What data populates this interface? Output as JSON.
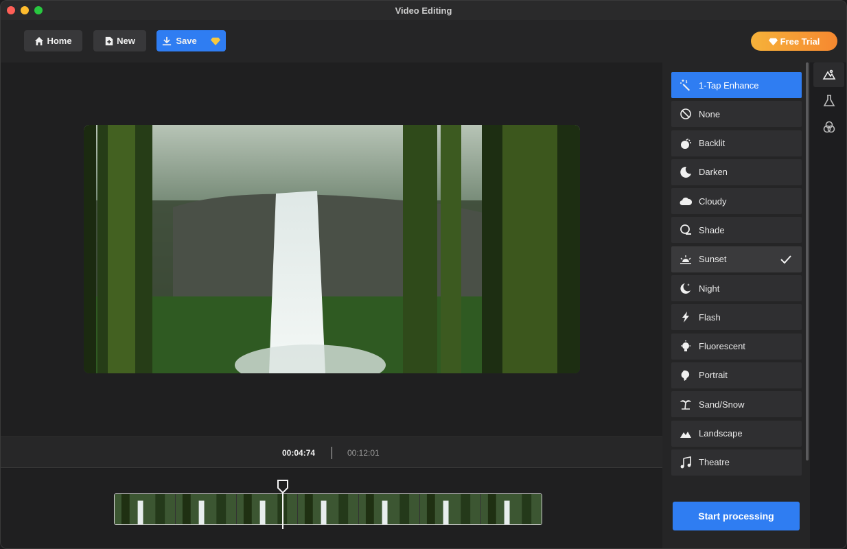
{
  "window": {
    "title": "Video Editing"
  },
  "toolbar": {
    "home_label": "Home",
    "new_label": "New",
    "save_label": "Save",
    "trial_label": "Free Trial"
  },
  "time": {
    "current": "00:04:74",
    "total": "00:12:01"
  },
  "presets": {
    "items": [
      {
        "label": "1-Tap Enhance",
        "icon": "magic-wand-icon",
        "state": "active"
      },
      {
        "label": "None",
        "icon": "none-icon",
        "state": ""
      },
      {
        "label": "Backlit",
        "icon": "backlit-icon",
        "state": ""
      },
      {
        "label": "Darken",
        "icon": "moon-icon",
        "state": ""
      },
      {
        "label": "Cloudy",
        "icon": "cloud-icon",
        "state": ""
      },
      {
        "label": "Shade",
        "icon": "shade-icon",
        "state": ""
      },
      {
        "label": "Sunset",
        "icon": "sunset-icon",
        "state": "selected"
      },
      {
        "label": "Night",
        "icon": "night-icon",
        "state": ""
      },
      {
        "label": "Flash",
        "icon": "flash-icon",
        "state": ""
      },
      {
        "label": "Fluorescent",
        "icon": "bulb-icon",
        "state": ""
      },
      {
        "label": "Portrait",
        "icon": "portrait-icon",
        "state": ""
      },
      {
        "label": "Sand/Snow",
        "icon": "palm-tree-icon",
        "state": ""
      },
      {
        "label": "Landscape",
        "icon": "mountain-icon",
        "state": ""
      },
      {
        "label": "Theatre",
        "icon": "music-note-icon",
        "state": ""
      }
    ]
  },
  "actions": {
    "process_label": "Start processing"
  },
  "colors": {
    "accent": "#2f7df2",
    "trial_start": "#f6b23a",
    "trial_end": "#f68830"
  }
}
